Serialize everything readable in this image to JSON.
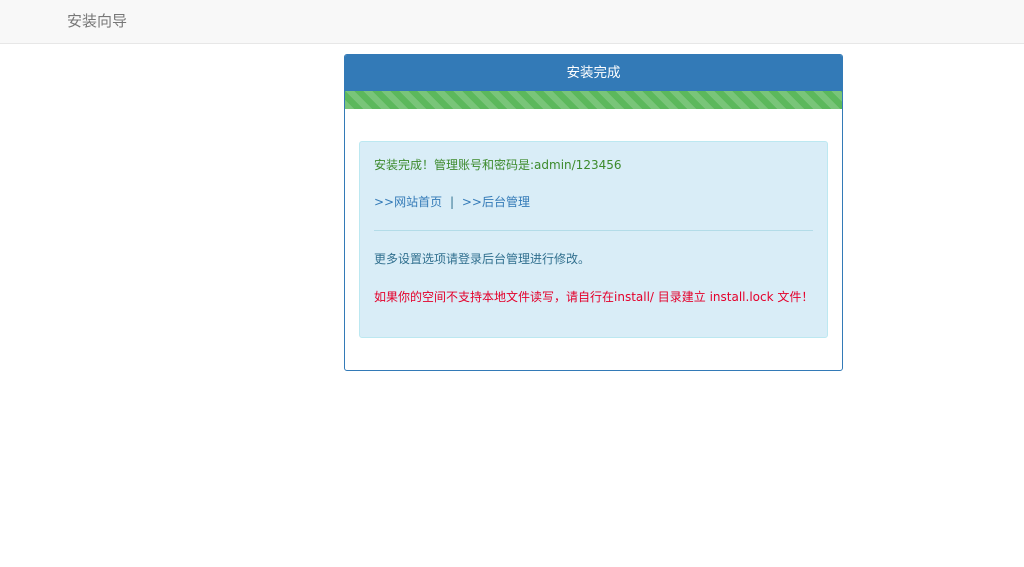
{
  "navbar": {
    "brand": "安装向导"
  },
  "panel": {
    "title": "安装完成",
    "progress_percent": 100,
    "colors": {
      "primary": "#337ab7",
      "progress": "#5cb85c",
      "alert_bg": "#d9edf7",
      "warning_text": "#e4002b"
    },
    "alert": {
      "success_message": "安装完成！管理账号和密码是:admin/123456",
      "links": [
        {
          "label": ">>网站首页"
        },
        {
          "label": ">>后台管理"
        }
      ],
      "separator": "|",
      "info_message": "更多设置选项请登录后台管理进行修改。",
      "warning_message": "如果你的空间不支持本地文件读写，请自行在install/ 目录建立 install.lock 文件！"
    }
  }
}
